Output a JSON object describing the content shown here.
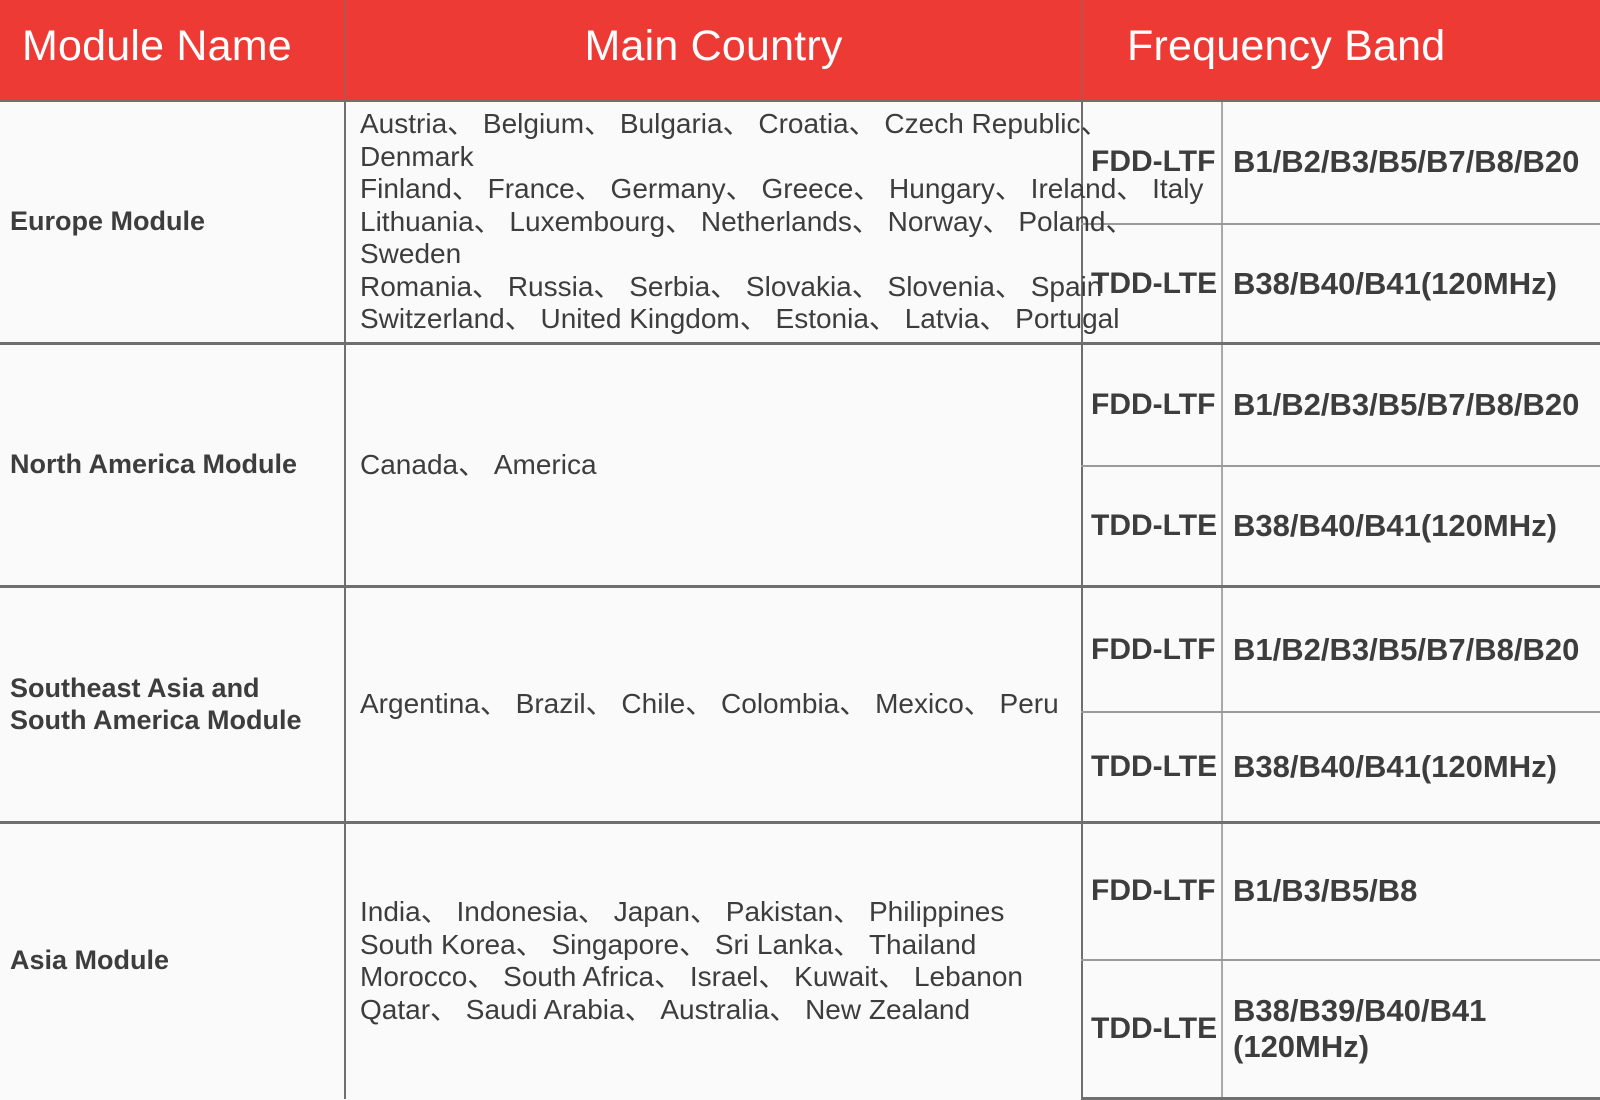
{
  "colors": {
    "header_bg": "#ee3a35",
    "header_text": "#ffffff",
    "body_text": "#3d3d3d",
    "body_bg": "#fbfafa",
    "major_border": "#6f6f6f",
    "minor_border": "#9a9a9a"
  },
  "header": {
    "col_module": "Module Name",
    "col_country": "Main Country",
    "col_band": "Frequency Band"
  },
  "rows": [
    {
      "module": "Europe Module",
      "country_lines": [
        "Austria、 Belgium、 Bulgaria、 Croatia、 Czech Republic、",
        "Denmark",
        "Finland、 France、 Germany、 Greece、 Hungary、 Ireland、 Italy",
        "Lithuania、 Luxembourg、 Netherlands、 Norway、 Poland、",
        "Sweden",
        "Romania、 Russia、 Serbia、 Slovakia、 Slovenia、 Spain",
        "Switzerland、 United Kingdom、 Estonia、 Latvia、 Portugal"
      ],
      "bands": [
        {
          "mode": "FDD-LTF",
          "value_lines": [
            "B1/B2/B3/B5/B7/B8/B20"
          ]
        },
        {
          "mode": "TDD-LTE",
          "value_lines": [
            "B38/B40/B41(120MHz)"
          ]
        }
      ]
    },
    {
      "module": "North America Module",
      "country_lines": [
        "Canada、 America"
      ],
      "bands": [
        {
          "mode": "FDD-LTF",
          "value_lines": [
            "B1/B2/B3/B5/B7/B8/B20"
          ]
        },
        {
          "mode": "TDD-LTE",
          "value_lines": [
            "B38/B40/B41(120MHz)"
          ]
        }
      ]
    },
    {
      "module": "Southeast Asia and South America Module",
      "country_lines": [
        "Argentina、 Brazil、 Chile、 Colombia、 Mexico、 Peru"
      ],
      "bands": [
        {
          "mode": "FDD-LTF",
          "value_lines": [
            "B1/B2/B3/B5/B7/B8/B20"
          ]
        },
        {
          "mode": "TDD-LTE",
          "value_lines": [
            "B38/B40/B41(120MHz)"
          ]
        }
      ]
    },
    {
      "module": "Asia Module",
      "country_lines": [
        "India、 Indonesia、 Japan、 Pakistan、 Philippines",
        "South Korea、 Singapore、 Sri Lanka、 Thailand",
        "Morocco、 South Africa、 Israel、 Kuwait、 Lebanon",
        "Qatar、 Saudi Arabia、 Australia、 New Zealand"
      ],
      "bands": [
        {
          "mode": "FDD-LTF",
          "value_lines": [
            "B1/B3/B5/B8"
          ]
        },
        {
          "mode": "TDD-LTE",
          "value_lines": [
            "B38/B39/B40/B41",
            "(120MHz)"
          ]
        }
      ]
    }
  ]
}
